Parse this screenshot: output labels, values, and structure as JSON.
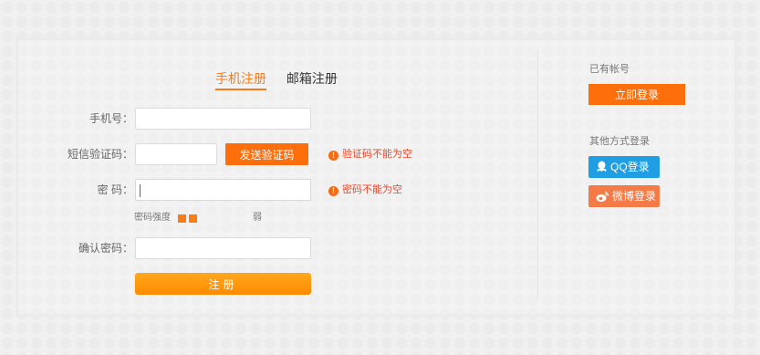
{
  "tabs": {
    "phone": "手机注册",
    "email": "邮箱注册"
  },
  "form": {
    "phone_label": "手机号：",
    "sms_label": "短信验证码：",
    "send_code_label": "发送验证码",
    "sms_error": "验证码不能为空",
    "password_label": "密 码：",
    "password_error": "密码不能为空",
    "strength_label": "密码强度",
    "strength_bars_total": 5,
    "strength_bars_filled": 2,
    "strength_value": "弱",
    "confirm_label": "确认密码：",
    "submit_label": "注册"
  },
  "sidebar": {
    "has_account": "已有帐号",
    "login_now": "立即登录",
    "other_login": "其他方式登录",
    "qq_login": "QQ登录",
    "weibo_login": "微博登录"
  },
  "colors": {
    "accent": "#f87d14",
    "button": "#fe6e0a",
    "qq": "#1f9ee3",
    "weibo": "#f47b48",
    "error": "#e64a2e"
  },
  "icons": {
    "error": "exclamation-circle-icon",
    "qq": "qq-icon",
    "weibo": "weibo-icon"
  }
}
